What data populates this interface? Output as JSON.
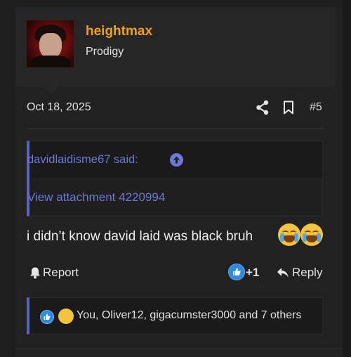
{
  "post": {
    "author": "heightmax",
    "author_title": "Prodigy",
    "date": "Oct 18, 2025",
    "post_number": "#5",
    "quote": {
      "author_line": "davidlaidisme67 said:",
      "attachment_link": "View attachment 4220994"
    },
    "message": "i didn’t know david laid was black bruh",
    "actions": {
      "report_label": "Report",
      "reaction_count": "+1",
      "reply_label": "Reply"
    },
    "reactions": {
      "reactors_text": "You, Oliver12, gigacumster3000 and 7 others"
    }
  },
  "icons": [
    "share-icon",
    "bookmark-icon",
    "arrow-up-circle-icon",
    "bell-icon",
    "like-icon",
    "reply-icon",
    "loudly-crying-face-emoji"
  ],
  "colors": {
    "username": "#f0a020",
    "quote_accent": "#5b64c2",
    "link": "#6d78d6",
    "like": "#2f8be0"
  }
}
